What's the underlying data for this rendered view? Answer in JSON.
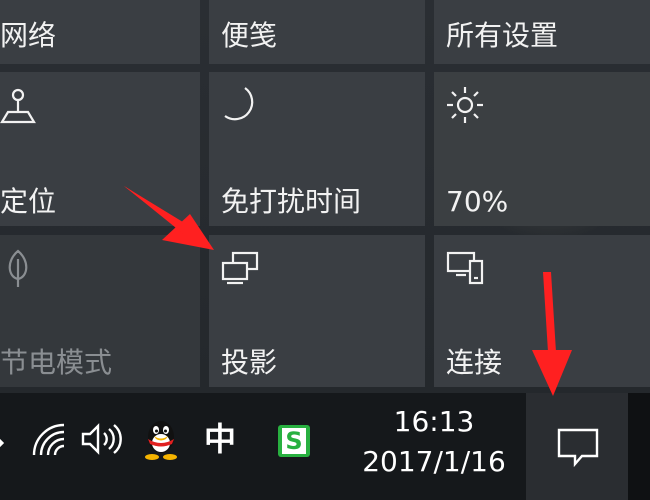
{
  "quick_actions": {
    "row0": [
      "网络",
      "便笺",
      "所有设置"
    ],
    "row1": [
      {
        "label": "定位",
        "icon": "location-icon"
      },
      {
        "label": "免打扰时间",
        "icon": "moon-icon"
      },
      {
        "label": "70%",
        "icon": "brightness-icon"
      }
    ],
    "row2": [
      {
        "label": "节电模式",
        "icon": "leaf-icon",
        "state": "disabled"
      },
      {
        "label": "投影",
        "icon": "project-icon"
      },
      {
        "label": "连接",
        "icon": "connect-icon"
      }
    ]
  },
  "taskbar": {
    "tray_icons": [
      "chevron-up-icon",
      "wifi-icon",
      "volume-icon",
      "qq-icon",
      "ime-indicator",
      "sogou-icon"
    ],
    "ime_label": "中",
    "sogou_label": "S",
    "clock": {
      "time": "16:13",
      "date": "2017/1/16"
    },
    "action_center_icon": "notification-icon"
  },
  "annotations": {
    "arrow_color": "#ff2020"
  }
}
